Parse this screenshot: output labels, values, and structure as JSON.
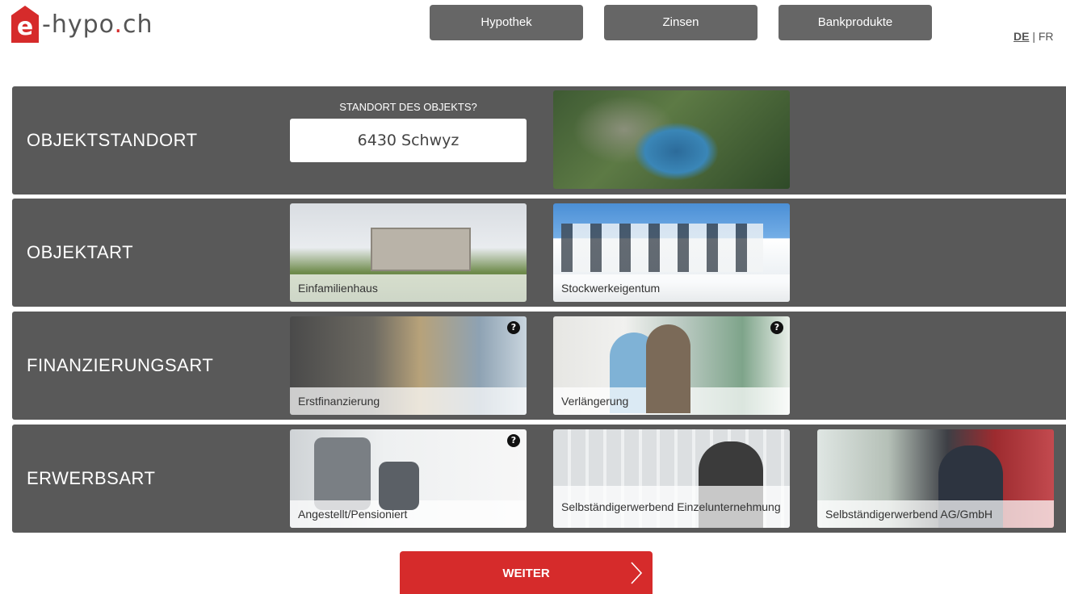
{
  "header": {
    "logo": {
      "e": "e",
      "text_before": "-hypo",
      "dot": ".",
      "text_after": "ch"
    },
    "nav": [
      {
        "label": "Hypothek"
      },
      {
        "label": "Zinsen"
      },
      {
        "label": "Bankprodukte"
      }
    ],
    "lang": {
      "active": "DE",
      "separator": "|",
      "other": "FR"
    }
  },
  "rows": {
    "standort": {
      "label": "OBJEKTSTANDORT",
      "question": "STANDORT DES OBJEKTS?",
      "value": "6430 Schwyz"
    },
    "objektart": {
      "label": "OBJEKTART",
      "options": [
        "Einfamilienhaus",
        "Stockwerkeigentum"
      ]
    },
    "finanzierungsart": {
      "label": "FINANZIERUNGSART",
      "options": [
        "Erstfinanzierung",
        "Verlängerung"
      ]
    },
    "erwerbsart": {
      "label": "ERWERBSART",
      "options": [
        "Angestellt/Pensioniert",
        "Selbständigerwerbend Einzelunternehmung",
        "Selbständigerwerbend AG/GmbH"
      ]
    }
  },
  "help_glyph": "?",
  "cta": {
    "label": "WEITER"
  },
  "colors": {
    "brand": "#d62b2b",
    "row_bg": "#595959",
    "nav_bg": "#666666"
  }
}
